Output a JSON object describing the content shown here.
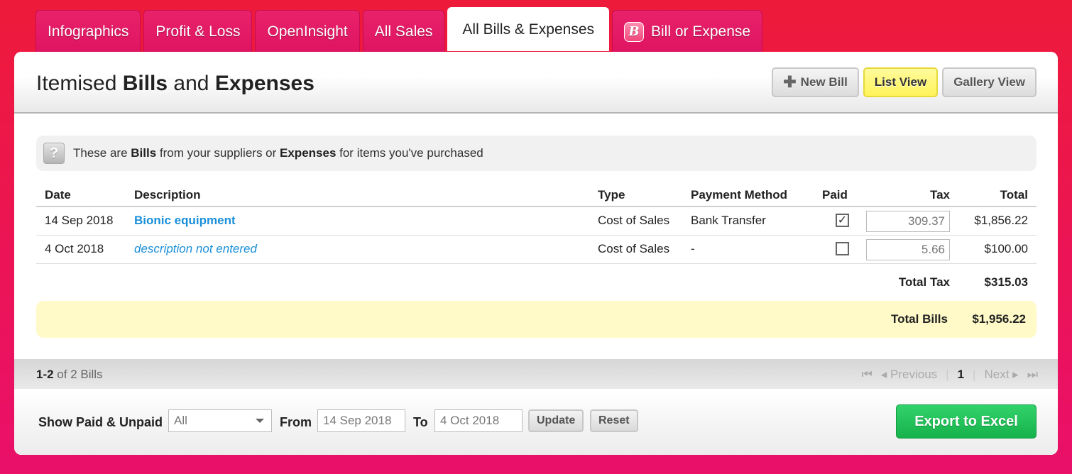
{
  "tabs": [
    {
      "label": "Infographics"
    },
    {
      "label": "Profit & Loss"
    },
    {
      "label": "OpenInsight"
    },
    {
      "label": "All Sales"
    },
    {
      "label": "All Bills & Expenses"
    },
    {
      "label": "Bill or Expense",
      "icon_letter": "B"
    }
  ],
  "title": {
    "part1": "Itemised ",
    "bold1": "Bills",
    "part2": " and ",
    "bold2": "Expenses"
  },
  "head_buttons": {
    "new_bill": "New Bill",
    "list_view": "List View",
    "gallery_view": "Gallery View"
  },
  "info": {
    "part1": "These are ",
    "bold1": "Bills",
    "part2": " from your suppliers or ",
    "bold2": "Expenses",
    "part3": " for items you've purchased",
    "icon": "?"
  },
  "columns": {
    "date": "Date",
    "description": "Description",
    "type": "Type",
    "payment": "Payment Method",
    "paid": "Paid",
    "tax": "Tax",
    "total": "Total"
  },
  "rows": [
    {
      "date": "14 Sep 2018",
      "description": "Bionic equipment",
      "type": "Cost of Sales",
      "payment": "Bank Transfer",
      "paid": true,
      "paid_mark": "✓",
      "tax": "309.37",
      "total": "$1,856.22"
    },
    {
      "date": "4 Oct 2018",
      "description": "description not entered",
      "type": "Cost of Sales",
      "payment": "-",
      "paid": false,
      "paid_mark": "",
      "tax": "5.66",
      "total": "$100.00"
    }
  ],
  "totals": {
    "tax_label": "Total Tax",
    "tax_value": "$315.03",
    "bills_label": "Total Bills",
    "bills_value": "$1,956.22"
  },
  "pager": {
    "range": "1-2",
    "of_text": " of 2 Bills",
    "previous": "◂ Previous",
    "page": "1",
    "next": "Next ▸",
    "first": "⏮",
    "last": "⏭",
    "sep": "|"
  },
  "filter": {
    "show_label": "Show Paid & Unpaid",
    "select_value": "All",
    "from_label": "From",
    "from_value": "14 Sep 2018",
    "to_label": "To",
    "to_value": "4 Oct 2018",
    "update": "Update",
    "reset": "Reset",
    "export": "Export to Excel"
  },
  "colors": {
    "accent": "#ee1a3a",
    "link": "#1a8fd8",
    "export": "#16b24c",
    "highlight": "#fffac8"
  }
}
